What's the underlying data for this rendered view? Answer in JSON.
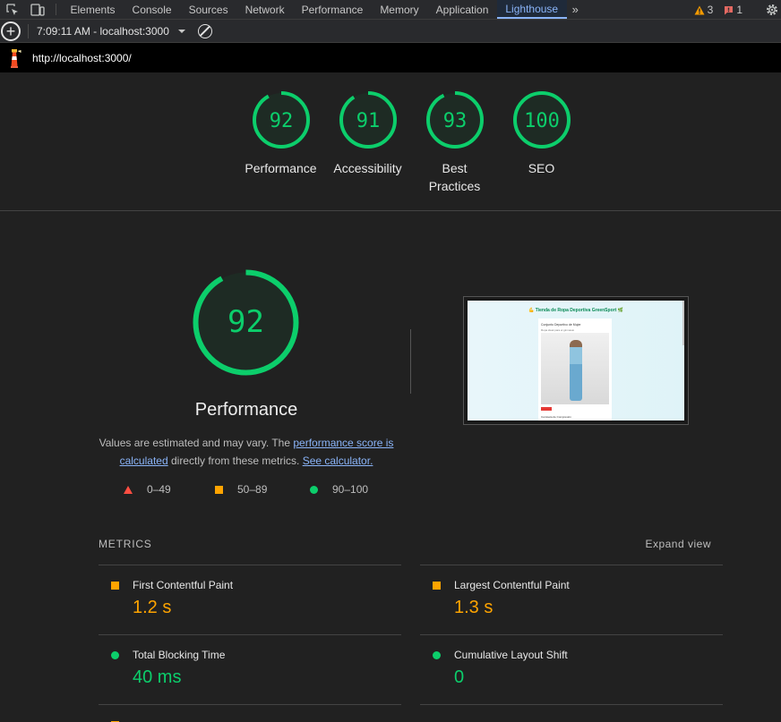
{
  "devtools": {
    "tabs": [
      "Elements",
      "Console",
      "Sources",
      "Network",
      "Performance",
      "Memory",
      "Application",
      "Lighthouse"
    ],
    "active_tab": "Lighthouse",
    "warnings_count": "3",
    "errors_count": "1"
  },
  "toolbar": {
    "report_label": "7:09:11 AM - localhost:3000"
  },
  "urlbar": {
    "url": "http://localhost:3000/"
  },
  "scores": [
    {
      "label": "Performance",
      "score": "92",
      "value": 92
    },
    {
      "label": "Accessibility",
      "score": "91",
      "value": 91
    },
    {
      "label": "Best Practices",
      "score": "93",
      "value": 93
    },
    {
      "label": "SEO",
      "score": "100",
      "value": 100
    }
  ],
  "performance": {
    "score": "92",
    "value": 92,
    "title": "Performance",
    "desc_prefix": "Values are estimated and may vary. The ",
    "desc_link1": "performance score is calculated",
    "desc_middle": " directly from these metrics. ",
    "desc_link2": "See calculator."
  },
  "legend": {
    "fail": "0–49",
    "average": "50–89",
    "pass": "90–100"
  },
  "screenshot": {
    "heading": "💪 Tienda de Ropa Deportiva GreenSport 🌿",
    "card_title": "Conjunto Deportivo de Mujer",
    "card_sub": "Ropa ideal para el gimnasio",
    "card_footer": "Camiseta de Compresión"
  },
  "metrics": {
    "title": "METRICS",
    "expand_label": "Expand view",
    "items": [
      {
        "name": "First Contentful Paint",
        "value": "1.2 s",
        "rating": "average"
      },
      {
        "name": "Largest Contentful Paint",
        "value": "1.3 s",
        "rating": "average"
      },
      {
        "name": "Total Blocking Time",
        "value": "40 ms",
        "rating": "pass"
      },
      {
        "name": "Cumulative Layout Shift",
        "value": "0",
        "rating": "pass"
      }
    ]
  },
  "colors": {
    "pass": "#0cce6b",
    "average": "#ffa400",
    "fail": "#ff4e42",
    "accent": "#8ab4f8"
  }
}
